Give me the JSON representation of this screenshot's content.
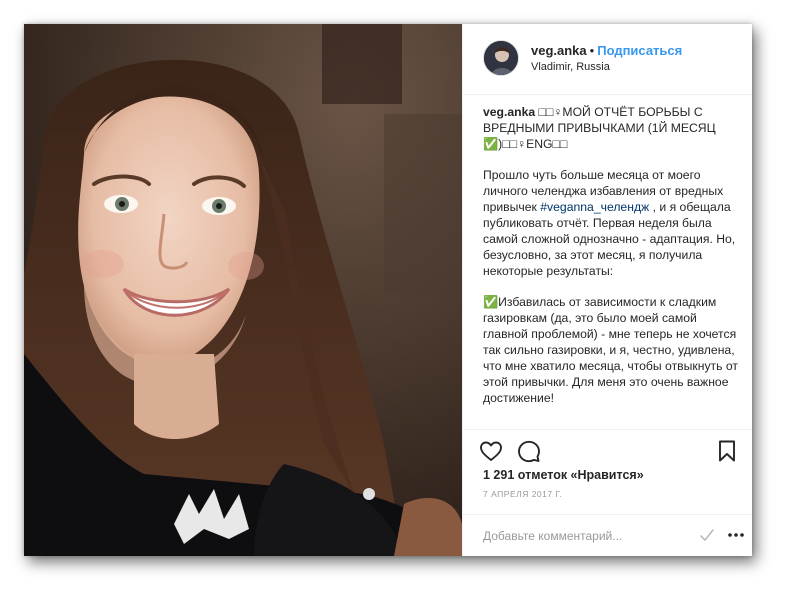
{
  "post": {
    "username": "veg.anka",
    "separator": "•",
    "follow_label": "Подписаться",
    "location": "Vladimir, Russia",
    "caption": {
      "username": "veg.anka",
      "title": " □□♀МОЙ ОТЧЁТ БОРЬБЫ С ВРЕДНЫМИ ПРИВЫЧКАМИ (1Й МЕСЯЦ ✅)□□♀ENG□□",
      "p1_before": "Прошло чуть больше месяца от моего личного челенджа избавления от вредных привычек ",
      "hashtag": "#veganna_челендж",
      "p1_after": " , и я обещала публиковать отчёт. Первая неделя была самой сложной однозначно - адаптация. Но, безусловно, за этот месяц, я получила некоторые результаты:",
      "p2": "✅Избавилась от зависимости к сладким газировкам (да, это было моей самой главной проблемой) - мне теперь не хочется так сильно газировки, и я, честно, удивлена, что мне хватило месяца, чтобы отвыкнуть от этой привычки. Для меня это очень важное достижение!"
    },
    "likes": "1 291 отметок «Нравится»",
    "date": "7 АПРЕЛЯ 2017 Г.",
    "comment_placeholder": "Добавьте комментарий..."
  },
  "icons": {
    "like": "heart-icon",
    "comment": "comment-icon",
    "save": "bookmark-icon",
    "emoji": "emoji-icon",
    "more": "more-icon"
  },
  "colors": {
    "link": "#3897f0",
    "hashtag": "#003569",
    "text": "#262626",
    "muted": "#999999"
  }
}
